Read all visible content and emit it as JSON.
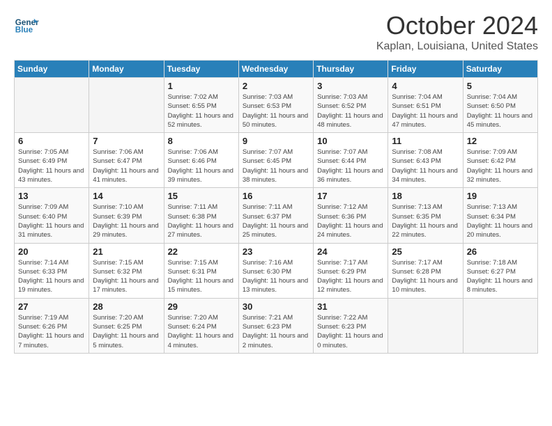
{
  "header": {
    "logo_general": "General",
    "logo_blue": "Blue",
    "month": "October 2024",
    "location": "Kaplan, Louisiana, United States"
  },
  "weekdays": [
    "Sunday",
    "Monday",
    "Tuesday",
    "Wednesday",
    "Thursday",
    "Friday",
    "Saturday"
  ],
  "weeks": [
    [
      {
        "day": "",
        "detail": ""
      },
      {
        "day": "",
        "detail": ""
      },
      {
        "day": "1",
        "detail": "Sunrise: 7:02 AM\nSunset: 6:55 PM\nDaylight: 11 hours and 52 minutes."
      },
      {
        "day": "2",
        "detail": "Sunrise: 7:03 AM\nSunset: 6:53 PM\nDaylight: 11 hours and 50 minutes."
      },
      {
        "day": "3",
        "detail": "Sunrise: 7:03 AM\nSunset: 6:52 PM\nDaylight: 11 hours and 48 minutes."
      },
      {
        "day": "4",
        "detail": "Sunrise: 7:04 AM\nSunset: 6:51 PM\nDaylight: 11 hours and 47 minutes."
      },
      {
        "day": "5",
        "detail": "Sunrise: 7:04 AM\nSunset: 6:50 PM\nDaylight: 11 hours and 45 minutes."
      }
    ],
    [
      {
        "day": "6",
        "detail": "Sunrise: 7:05 AM\nSunset: 6:49 PM\nDaylight: 11 hours and 43 minutes."
      },
      {
        "day": "7",
        "detail": "Sunrise: 7:06 AM\nSunset: 6:47 PM\nDaylight: 11 hours and 41 minutes."
      },
      {
        "day": "8",
        "detail": "Sunrise: 7:06 AM\nSunset: 6:46 PM\nDaylight: 11 hours and 39 minutes."
      },
      {
        "day": "9",
        "detail": "Sunrise: 7:07 AM\nSunset: 6:45 PM\nDaylight: 11 hours and 38 minutes."
      },
      {
        "day": "10",
        "detail": "Sunrise: 7:07 AM\nSunset: 6:44 PM\nDaylight: 11 hours and 36 minutes."
      },
      {
        "day": "11",
        "detail": "Sunrise: 7:08 AM\nSunset: 6:43 PM\nDaylight: 11 hours and 34 minutes."
      },
      {
        "day": "12",
        "detail": "Sunrise: 7:09 AM\nSunset: 6:42 PM\nDaylight: 11 hours and 32 minutes."
      }
    ],
    [
      {
        "day": "13",
        "detail": "Sunrise: 7:09 AM\nSunset: 6:40 PM\nDaylight: 11 hours and 31 minutes."
      },
      {
        "day": "14",
        "detail": "Sunrise: 7:10 AM\nSunset: 6:39 PM\nDaylight: 11 hours and 29 minutes."
      },
      {
        "day": "15",
        "detail": "Sunrise: 7:11 AM\nSunset: 6:38 PM\nDaylight: 11 hours and 27 minutes."
      },
      {
        "day": "16",
        "detail": "Sunrise: 7:11 AM\nSunset: 6:37 PM\nDaylight: 11 hours and 25 minutes."
      },
      {
        "day": "17",
        "detail": "Sunrise: 7:12 AM\nSunset: 6:36 PM\nDaylight: 11 hours and 24 minutes."
      },
      {
        "day": "18",
        "detail": "Sunrise: 7:13 AM\nSunset: 6:35 PM\nDaylight: 11 hours and 22 minutes."
      },
      {
        "day": "19",
        "detail": "Sunrise: 7:13 AM\nSunset: 6:34 PM\nDaylight: 11 hours and 20 minutes."
      }
    ],
    [
      {
        "day": "20",
        "detail": "Sunrise: 7:14 AM\nSunset: 6:33 PM\nDaylight: 11 hours and 19 minutes."
      },
      {
        "day": "21",
        "detail": "Sunrise: 7:15 AM\nSunset: 6:32 PM\nDaylight: 11 hours and 17 minutes."
      },
      {
        "day": "22",
        "detail": "Sunrise: 7:15 AM\nSunset: 6:31 PM\nDaylight: 11 hours and 15 minutes."
      },
      {
        "day": "23",
        "detail": "Sunrise: 7:16 AM\nSunset: 6:30 PM\nDaylight: 11 hours and 13 minutes."
      },
      {
        "day": "24",
        "detail": "Sunrise: 7:17 AM\nSunset: 6:29 PM\nDaylight: 11 hours and 12 minutes."
      },
      {
        "day": "25",
        "detail": "Sunrise: 7:17 AM\nSunset: 6:28 PM\nDaylight: 11 hours and 10 minutes."
      },
      {
        "day": "26",
        "detail": "Sunrise: 7:18 AM\nSunset: 6:27 PM\nDaylight: 11 hours and 8 minutes."
      }
    ],
    [
      {
        "day": "27",
        "detail": "Sunrise: 7:19 AM\nSunset: 6:26 PM\nDaylight: 11 hours and 7 minutes."
      },
      {
        "day": "28",
        "detail": "Sunrise: 7:20 AM\nSunset: 6:25 PM\nDaylight: 11 hours and 5 minutes."
      },
      {
        "day": "29",
        "detail": "Sunrise: 7:20 AM\nSunset: 6:24 PM\nDaylight: 11 hours and 4 minutes."
      },
      {
        "day": "30",
        "detail": "Sunrise: 7:21 AM\nSunset: 6:23 PM\nDaylight: 11 hours and 2 minutes."
      },
      {
        "day": "31",
        "detail": "Sunrise: 7:22 AM\nSunset: 6:23 PM\nDaylight: 11 hours and 0 minutes."
      },
      {
        "day": "",
        "detail": ""
      },
      {
        "day": "",
        "detail": ""
      }
    ]
  ]
}
